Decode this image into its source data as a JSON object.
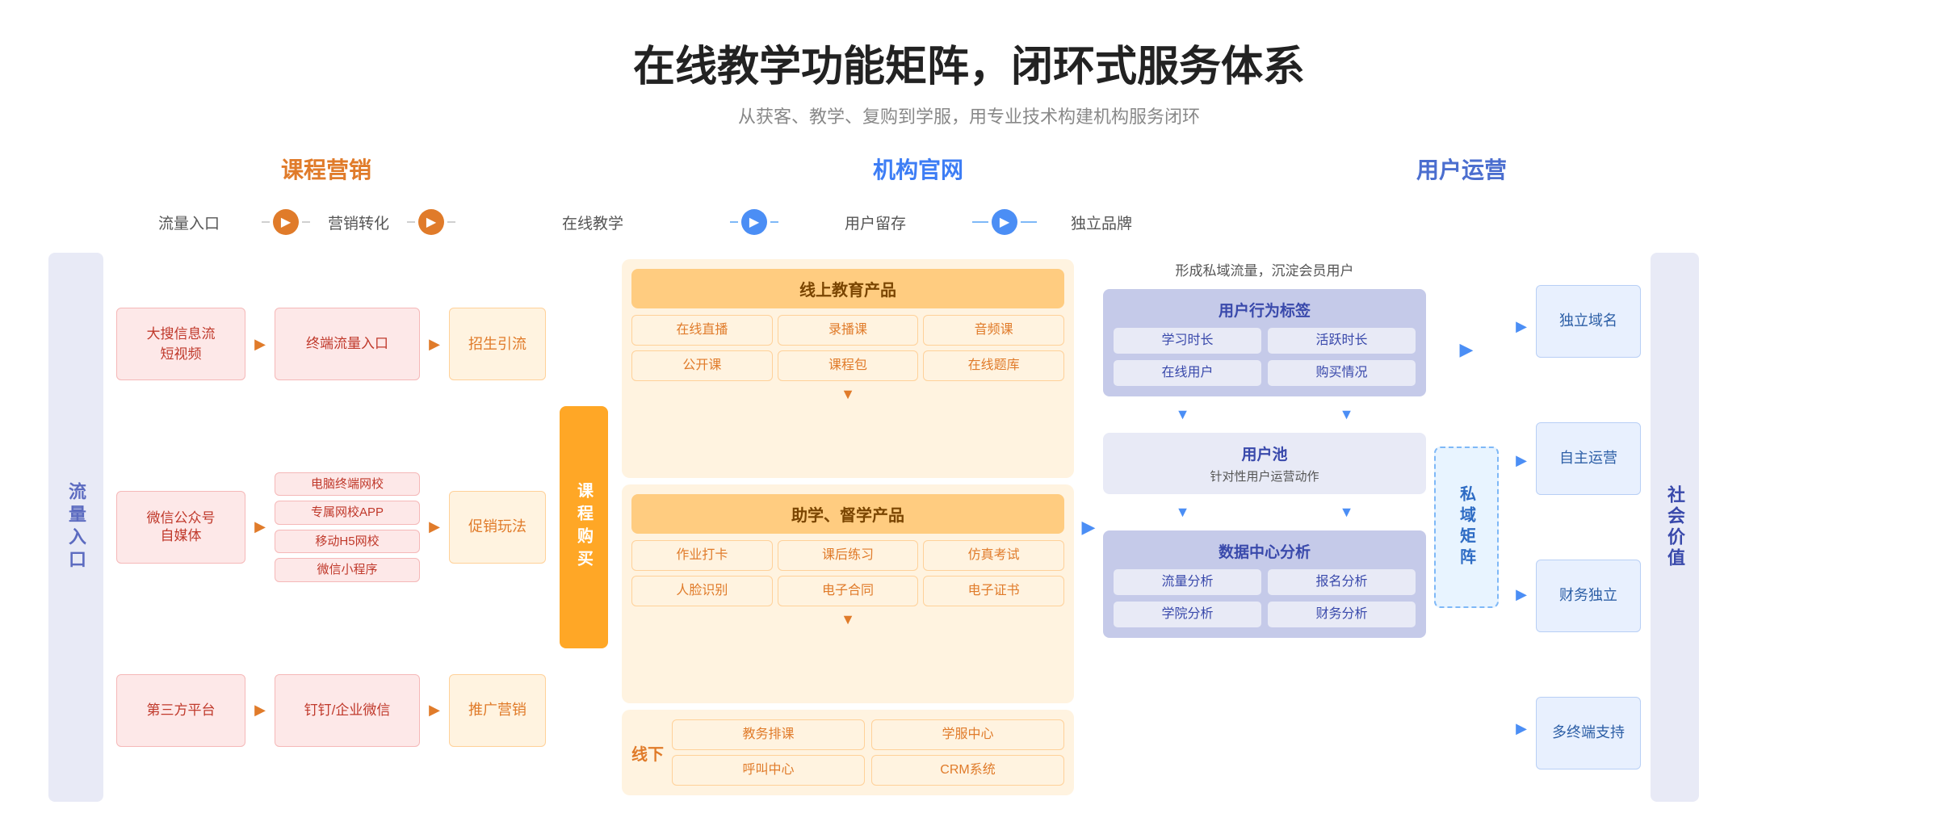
{
  "header": {
    "title": "在线教学功能矩阵，闭环式服务体系",
    "subtitle": "从获客、教学、复购到学服，用专业技术构建机构服务闭环"
  },
  "sections": {
    "keChengYingXiao": "课程营销",
    "jiGouGuanWang": "机构官网",
    "yongHuYunYing": "用户运营"
  },
  "flow_labels": {
    "liuLiangRuKou": "流量入口",
    "yingXiaoZhuanHua": "营销转化",
    "zaiXianJiaoXue": "在线教学",
    "yongHuLiuCun": "用户留存",
    "duLiPinPai": "独立品牌"
  },
  "left_label": "流量入口",
  "traffic_sources": [
    {
      "label": "大搜信息流短视频",
      "next": "终端流量入口",
      "color": "pink"
    },
    {
      "label": "微信公众号自媒体",
      "nexts": [
        "电脑终端网校",
        "专属网校APP",
        "移动H5网校",
        "微信小程序"
      ],
      "color": "pink"
    },
    {
      "label": "第三方平台",
      "next": "钉钉/企业微信",
      "color": "pink"
    }
  ],
  "marketing_conversion": [
    {
      "label": "招生引流"
    },
    {
      "label": "促销玩法"
    },
    {
      "label": "推广营销"
    }
  ],
  "vertical_box": "课程购买",
  "online_teaching": {
    "title": "线上教育产品",
    "items1": [
      "在线直播",
      "录播课",
      "音频课"
    ],
    "items2": [
      "公开课",
      "课程包",
      "在线题库"
    ],
    "title2": "助学、督学产品",
    "items3": [
      "作业打卡",
      "课后练习",
      "仿真考试"
    ],
    "items4": [
      "人脸识别",
      "电子合同",
      "电子证书"
    ],
    "offline": "线下",
    "offline_items1": [
      "教务排课",
      "学服中心"
    ],
    "offline_items2": [
      "呼叫中心",
      "CRM系统"
    ]
  },
  "user_retention": {
    "private_flow_text": "形成私域流量，沉淀会员用户",
    "behavior_tag": "用户行为标签",
    "tags": [
      [
        "学习时长",
        "活跃时长"
      ],
      [
        "在线用户",
        "购买情况"
      ]
    ],
    "user_pool": "用户池",
    "user_pool_sub": "针对性用户运营动作",
    "data_center": "数据中心分析",
    "data_items1": [
      "流量分析",
      "报名分析"
    ],
    "data_items2": [
      "学院分析",
      "财务分析"
    ]
  },
  "private_matrix": "私域矩阵",
  "brand": {
    "items": [
      "独立域名",
      "自主运营",
      "财务独立",
      "多终端支持"
    ]
  },
  "right_label": "社会价值",
  "arrows": {
    "orange_circle": "▶",
    "blue_circle": "▶",
    "right_arrow": "▶",
    "down_arrow": "▼"
  }
}
